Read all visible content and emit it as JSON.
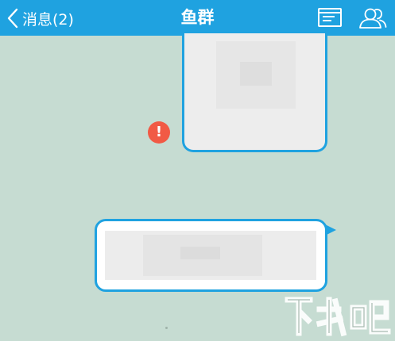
{
  "header": {
    "back_label": "消息(2)",
    "title": "鱼群",
    "icons": [
      "chevron-left-icon",
      "document-list-icon",
      "group-members-icon"
    ]
  },
  "colors": {
    "header_bg": "#1fa2e0",
    "chat_bg": "#c6dcd2",
    "bubble_border": "#1fa2e0",
    "error": "#f15a45"
  },
  "messages": [
    {
      "type": "image",
      "status": "send-failed",
      "status_icon": "exclamation-icon"
    },
    {
      "type": "card"
    }
  ],
  "watermark": {
    "icon": "site-watermark-logo"
  }
}
